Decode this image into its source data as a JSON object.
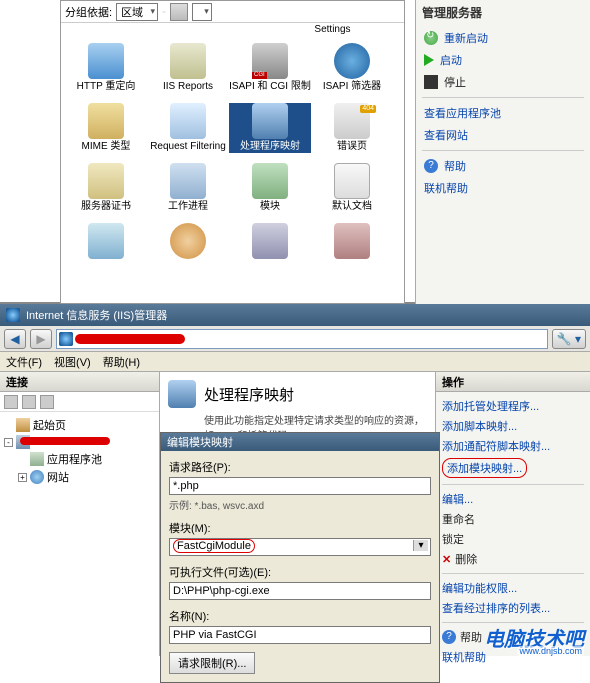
{
  "top": {
    "group_label": "分组依据:",
    "group_value": "区域",
    "settings_label": "Settings",
    "icons": [
      [
        {
          "name": "http-redirect",
          "label": "HTTP 重定向"
        },
        {
          "name": "iis-reports",
          "label": "IIS Reports"
        },
        {
          "name": "isapi-cgi",
          "label": "ISAPI 和 CGI 限制"
        },
        {
          "name": "isapi-filter",
          "label": "ISAPI 筛选器"
        }
      ],
      [
        {
          "name": "mime-types",
          "label": "MIME 类型"
        },
        {
          "name": "request-filtering",
          "label": "Request Filtering"
        },
        {
          "name": "handler-mappings",
          "label": "处理程序映射",
          "selected": true
        },
        {
          "name": "error-pages",
          "label": "错误页"
        }
      ],
      [
        {
          "name": "server-cert",
          "label": "服务器证书"
        },
        {
          "name": "worker-process",
          "label": "工作进程"
        },
        {
          "name": "modules",
          "label": "模块"
        },
        {
          "name": "default-doc",
          "label": "默认文档"
        }
      ],
      [
        {
          "name": "gen1",
          "label": ""
        },
        {
          "name": "gen2",
          "label": ""
        },
        {
          "name": "gen3",
          "label": ""
        },
        {
          "name": "gen4",
          "label": ""
        }
      ]
    ]
  },
  "top_actions": {
    "title": "管理服务器",
    "restart": "重新启动",
    "start": "启动",
    "stop": "停止",
    "view_app_pools": "查看应用程序池",
    "view_sites": "查看网站",
    "help": "帮助",
    "online_help": "联机帮助"
  },
  "iis": {
    "window_title": "Internet 信息服务 (IIS)管理器",
    "menu": {
      "file": "文件(F)",
      "view": "视图(V)",
      "help": "帮助(H)"
    },
    "tree": {
      "header": "连接",
      "start": "起始页",
      "app_pools": "应用程序池",
      "sites": "网站"
    },
    "center": {
      "title": "处理程序映射",
      "desc": "使用此功能指定处理特定请求类型的响应的资源，如 DLL 和托管代码。"
    },
    "dialog": {
      "title": "编辑模块映射",
      "path_label": "请求路径(P):",
      "path_value": "*.php",
      "path_hint": "示例: *.bas, wsvc.axd",
      "module_label": "模块(M):",
      "module_value": "FastCgiModule",
      "exec_label": "可执行文件(可选)(E):",
      "exec_value": "D:\\PHP\\php-cgi.exe",
      "name_label": "名称(N):",
      "name_value": "PHP via FastCGI",
      "restrict_btn": "请求限制(R)..."
    },
    "actions": {
      "header": "操作",
      "add_managed": "添加托管处理程序...",
      "add_script": "添加脚本映射...",
      "add_wildcard": "添加通配符脚本映射...",
      "add_module": "添加模块映射...",
      "edit": "编辑...",
      "rename": "重命名",
      "lock": "锁定",
      "delete": "删除",
      "edit_perms": "编辑功能权限...",
      "view_ordered": "查看经过排序的列表...",
      "help": "帮助",
      "online_help": "联机帮助"
    }
  },
  "watermark": {
    "text": "电脑技术吧",
    "url": "www.dnjsb.com"
  }
}
